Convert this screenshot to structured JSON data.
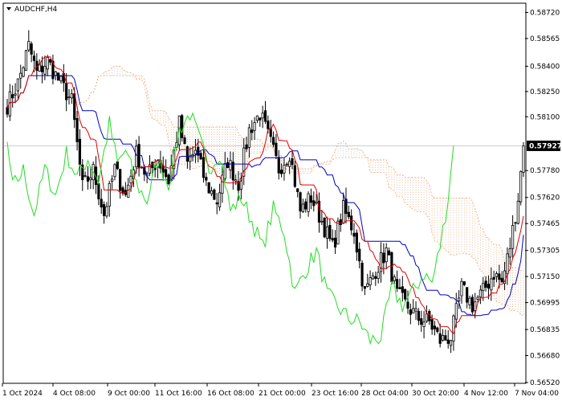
{
  "symbol_label": "AUDCHF,H4",
  "price_badge": "0.57927",
  "colors": {
    "background": "#ffffff",
    "axis": "#000000",
    "candle": "#000000",
    "tenkan": "#e00000",
    "kijun": "#0000c0",
    "chikou": "#22dd22",
    "cloud": "#e8a070",
    "cloud_alt": "#b8b8b8",
    "badge_bg": "#000000",
    "badge_text": "#ffffff",
    "price_line": "#b0b0b0"
  },
  "chart_data": {
    "type": "candlestick-ichimoku",
    "instrument": "AUDCHF",
    "timeframe": "H4",
    "ylim": [
      0.5652,
      0.5877
    ],
    "y_ticks": [
      "0.58720",
      "0.58565",
      "0.58400",
      "0.58250",
      "0.58100",
      "0.57780",
      "0.57620",
      "0.57465",
      "0.57305",
      "0.57150",
      "0.56995",
      "0.56835",
      "0.56680",
      "0.56520"
    ],
    "x_ticks": [
      "1 Oct 2024",
      "4 Oct 08:00",
      "9 Oct 00:00",
      "11 Oct 16:00",
      "16 Oct 08:00",
      "21 Oct 00:00",
      "23 Oct 16:00",
      "28 Oct 04:00",
      "30 Oct 20:00",
      "4 Nov 12:00",
      "7 Nov 04:00"
    ],
    "last_price": 0.57927,
    "close_path": [
      [
        0,
        0.5817
      ],
      [
        4,
        0.583
      ],
      [
        8,
        0.5852
      ],
      [
        11,
        0.5836
      ],
      [
        15,
        0.5843
      ],
      [
        19,
        0.5832
      ],
      [
        24,
        0.5819
      ],
      [
        28,
        0.5768
      ],
      [
        32,
        0.5778
      ],
      [
        36,
        0.5752
      ],
      [
        40,
        0.5779
      ],
      [
        44,
        0.5763
      ],
      [
        48,
        0.5788
      ],
      [
        52,
        0.5774
      ],
      [
        56,
        0.5785
      ],
      [
        60,
        0.5772
      ],
      [
        64,
        0.5806
      ],
      [
        67,
        0.5782
      ],
      [
        70,
        0.579
      ],
      [
        74,
        0.577
      ],
      [
        78,
        0.576
      ],
      [
        82,
        0.5784
      ],
      [
        86,
        0.577
      ],
      [
        90,
        0.5802
      ],
      [
        94,
        0.5812
      ],
      [
        98,
        0.5794
      ],
      [
        101,
        0.5779
      ],
      [
        105,
        0.5789
      ],
      [
        109,
        0.5754
      ],
      [
        113,
        0.5762
      ],
      [
        117,
        0.5748
      ],
      [
        121,
        0.5732
      ],
      [
        125,
        0.5755
      ],
      [
        129,
        0.5742
      ],
      [
        133,
        0.5705
      ],
      [
        137,
        0.5719
      ],
      [
        141,
        0.573
      ],
      [
        145,
        0.5704
      ],
      [
        149,
        0.5697
      ],
      [
        153,
        0.569
      ],
      [
        157,
        0.5688
      ],
      [
        161,
        0.5677
      ],
      [
        165,
        0.5679
      ],
      [
        169,
        0.5708
      ],
      [
        173,
        0.5698
      ],
      [
        177,
        0.5706
      ],
      [
        181,
        0.5717
      ],
      [
        184,
        0.5711
      ],
      [
        187,
        0.5733
      ],
      [
        190,
        0.5762
      ],
      [
        192,
        0.5792
      ]
    ]
  }
}
